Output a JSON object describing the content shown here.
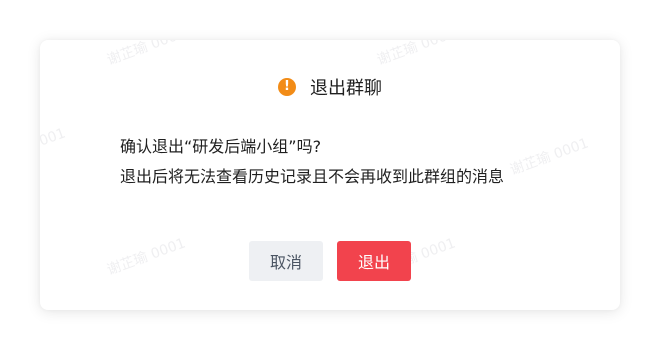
{
  "dialog": {
    "title": "退出群聊",
    "icon": "warning-icon",
    "message_line1": "确认退出“研发后端小组”吗?",
    "message_line2": "退出后将无法查看历史记录且不会再收到此群组的消息",
    "cancel_label": "取消",
    "confirm_label": "退出"
  },
  "watermark": {
    "text": "谢芷瑜 0001"
  },
  "colors": {
    "warning": "#f28c17",
    "danger": "#f2434d",
    "cancel_bg": "#eef0f3"
  }
}
